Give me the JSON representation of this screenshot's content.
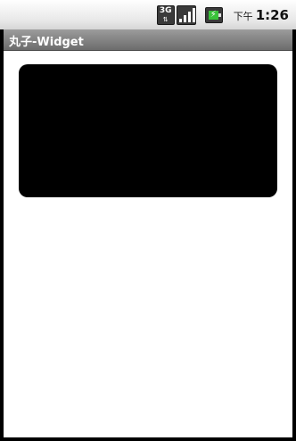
{
  "status_bar": {
    "network_type": "3G",
    "network_arrows": "⇅",
    "ampm": "下午",
    "time": "1:26",
    "icons": [
      "3g-icon",
      "signal-icon",
      "battery-charging-icon"
    ]
  },
  "app": {
    "title": "丸子-Widget"
  },
  "colors": {
    "background": "#ffffff",
    "title_bar": "#7f7f7f",
    "widget_card": "#000000",
    "battery": "#3ac23a"
  }
}
